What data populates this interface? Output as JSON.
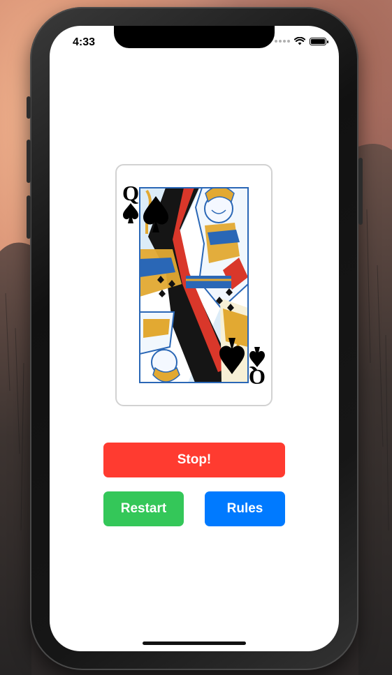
{
  "status_bar": {
    "time": "4:33",
    "icons": [
      "signal-dots-icon",
      "wifi-icon",
      "battery-icon"
    ]
  },
  "card": {
    "rank": "Q",
    "suit": "♠",
    "art": "queen-of-spades-illustration"
  },
  "buttons": {
    "stop_label": "Stop!",
    "restart_label": "Restart",
    "rules_label": "Rules"
  },
  "colors": {
    "stop": "#ff3b30",
    "restart": "#34c759",
    "rules": "#007aff",
    "card_blue": "#2a67b6",
    "card_gold": "#e2a932",
    "card_red": "#d9372a"
  }
}
